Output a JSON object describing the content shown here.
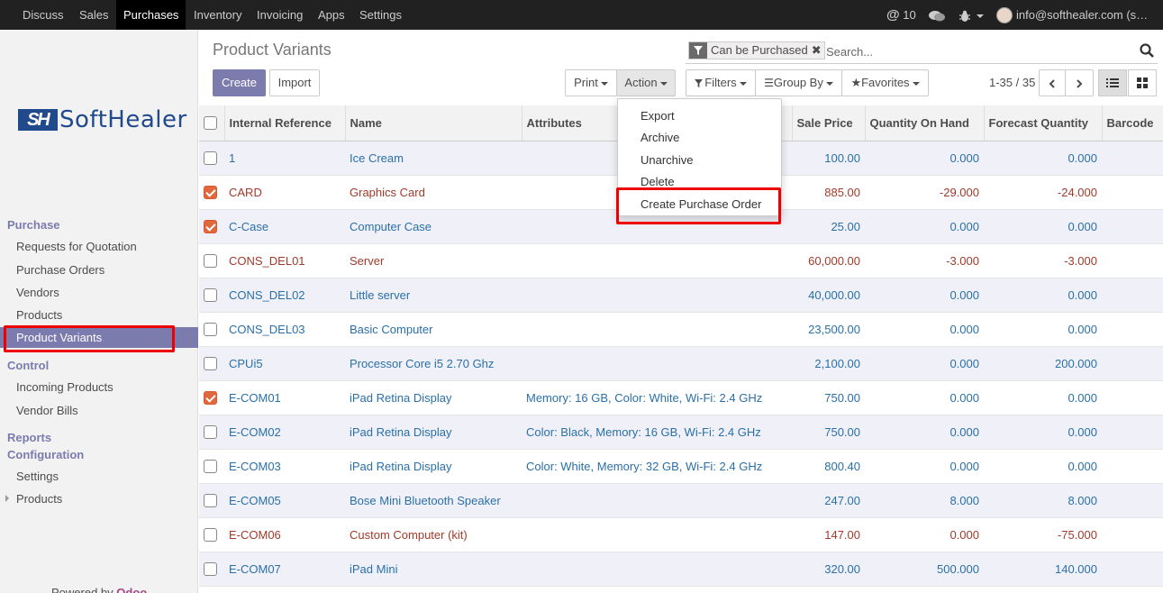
{
  "topbar": {
    "menus": [
      "Discuss",
      "Sales",
      "Purchases",
      "Inventory",
      "Invoicing",
      "Apps",
      "Settings"
    ],
    "active_menu": "Purchases",
    "mentions_count": "10",
    "user": "info@softhealer.com (s…"
  },
  "sidebar": {
    "logo_mark": "SH",
    "logo_text": "SoftHealer",
    "purchase_section": "Purchase",
    "purchase_items": [
      "Requests for Quotation",
      "Purchase Orders",
      "Vendors",
      "Products",
      "Product Variants"
    ],
    "active_item": "Product Variants",
    "control_section": "Control",
    "control_items": [
      "Incoming Products",
      "Vendor Bills"
    ],
    "reports_section": "Reports",
    "configuration_section": "Configuration",
    "configuration_items": [
      "Settings",
      "Products"
    ],
    "powered_by": "Powered by",
    "powered_brand": "Odoo"
  },
  "control_panel": {
    "title": "Product Variants",
    "create_label": "Create",
    "import_label": "Import",
    "print_label": "Print",
    "action_label": "Action",
    "filters_label": "Filters",
    "group_by_label": "Group By",
    "favorites_label": "Favorites",
    "search_facet": "Can be Purchased",
    "search_placeholder": "Search...",
    "pager": "1-35 / 35"
  },
  "action_menu": {
    "items": [
      "Export",
      "Archive",
      "Unarchive",
      "Delete",
      "Create Purchase Order"
    ],
    "highlighted": "Create Purchase Order"
  },
  "table": {
    "columns": [
      "Internal Reference",
      "Name",
      "Attributes",
      "Sale Price",
      "Quantity On Hand",
      "Forecast Quantity",
      "Barcode"
    ],
    "rows": [
      {
        "checked": false,
        "ref": "1",
        "name": "Ice Cream",
        "attributes": "",
        "price": "100.00",
        "qty": "0.000",
        "forecast": "0.000",
        "style": "blue"
      },
      {
        "checked": true,
        "ref": "CARD",
        "name": "Graphics Card",
        "attributes": "",
        "price": "885.00",
        "qty": "-29.000",
        "forecast": "-24.000",
        "style": "red"
      },
      {
        "checked": true,
        "ref": "C-Case",
        "name": "Computer Case",
        "attributes": "",
        "price": "25.00",
        "qty": "0.000",
        "forecast": "0.000",
        "style": "blue"
      },
      {
        "checked": false,
        "ref": "CONS_DEL01",
        "name": "Server",
        "attributes": "",
        "price": "60,000.00",
        "qty": "-3.000",
        "forecast": "-3.000",
        "style": "red"
      },
      {
        "checked": false,
        "ref": "CONS_DEL02",
        "name": "Little server",
        "attributes": "",
        "price": "40,000.00",
        "qty": "0.000",
        "forecast": "0.000",
        "style": "blue"
      },
      {
        "checked": false,
        "ref": "CONS_DEL03",
        "name": "Basic Computer",
        "attributes": "",
        "price": "23,500.00",
        "qty": "0.000",
        "forecast": "0.000",
        "style": "blue"
      },
      {
        "checked": false,
        "ref": "CPUi5",
        "name": "Processor Core i5 2.70 Ghz",
        "attributes": "",
        "price": "2,100.00",
        "qty": "0.000",
        "forecast": "200.000",
        "style": "blue"
      },
      {
        "checked": true,
        "ref": "E-COM01",
        "name": "iPad Retina Display",
        "attributes": "Memory: 16 GB, Color: White, Wi-Fi: 2.4 GHz",
        "price": "750.00",
        "qty": "0.000",
        "forecast": "0.000",
        "style": "blue"
      },
      {
        "checked": false,
        "ref": "E-COM02",
        "name": "iPad Retina Display",
        "attributes": "Color: Black, Memory: 16 GB, Wi-Fi: 2.4 GHz",
        "price": "750.00",
        "qty": "0.000",
        "forecast": "0.000",
        "style": "blue"
      },
      {
        "checked": false,
        "ref": "E-COM03",
        "name": "iPad Retina Display",
        "attributes": "Color: White, Memory: 32 GB, Wi-Fi: 2.4 GHz",
        "price": "800.40",
        "qty": "0.000",
        "forecast": "0.000",
        "style": "blue"
      },
      {
        "checked": false,
        "ref": "E-COM05",
        "name": "Bose Mini Bluetooth Speaker",
        "attributes": "",
        "price": "247.00",
        "qty": "8.000",
        "forecast": "8.000",
        "style": "blue"
      },
      {
        "checked": false,
        "ref": "E-COM06",
        "name": "Custom Computer (kit)",
        "attributes": "",
        "price": "147.00",
        "qty": "0.000",
        "forecast": "-75.000",
        "style": "red"
      },
      {
        "checked": false,
        "ref": "E-COM07",
        "name": "iPad Mini",
        "attributes": "",
        "price": "320.00",
        "qty": "500.000",
        "forecast": "140.000",
        "style": "blue"
      }
    ]
  },
  "colors": {
    "accent": "#7c7bad",
    "topbar": "#212121",
    "link_blue": "#2a6fa8",
    "warning_red": "#a03b2b",
    "checkbox_on": "#e1683c",
    "highlight_box": "#ee0000"
  }
}
